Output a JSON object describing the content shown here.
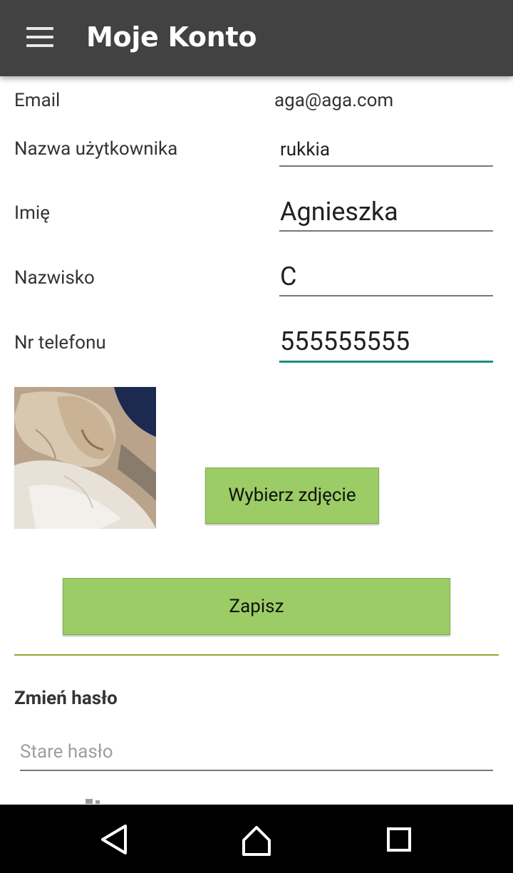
{
  "app_bar": {
    "title": "Moje Konto",
    "menu_icon": "hamburger-menu-icon",
    "background": "#424242"
  },
  "form": {
    "email": {
      "label": "Email",
      "value": "aga@aga.com"
    },
    "username": {
      "label": "Nazwa użytkownika",
      "value": "rukkia"
    },
    "first_name": {
      "label": "Imię",
      "value": "Agnieszka"
    },
    "last_name": {
      "label": "Nazwisko",
      "value": "C"
    },
    "phone": {
      "label": "Nr telefonu",
      "value": "555555555"
    }
  },
  "photo": {
    "choose_button": "Wybierz zdjęcie"
  },
  "save_button": "Zapisz",
  "change_password": {
    "title": "Zmień hasło",
    "old_password_placeholder": "Stare hasło"
  },
  "colors": {
    "button_green": "#9ccc65",
    "focus_teal": "#1e8e7e",
    "divider_olive": "#8fa630"
  },
  "nav_bar": {
    "icons": [
      "back-triangle-icon",
      "home-icon",
      "recents-square-icon"
    ]
  }
}
